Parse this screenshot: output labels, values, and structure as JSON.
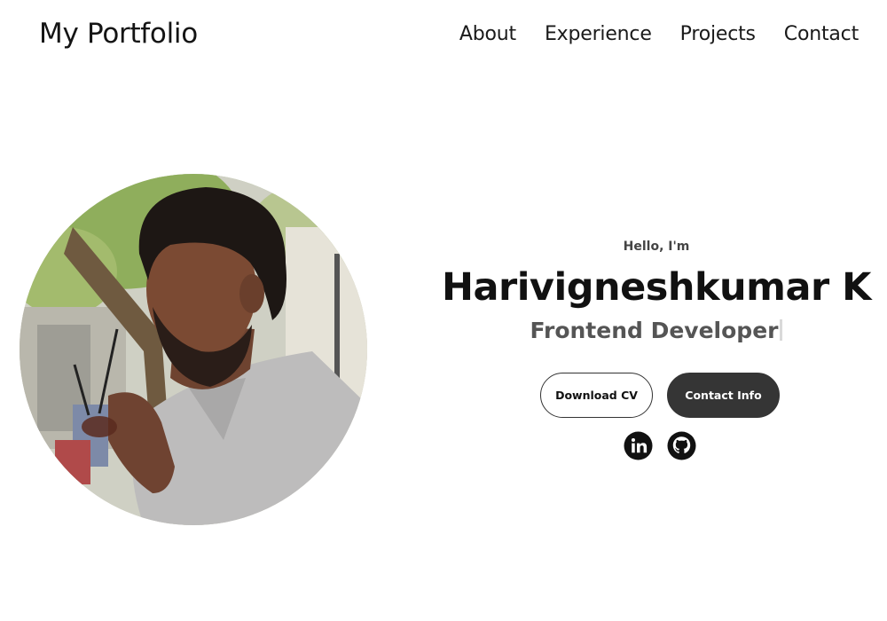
{
  "nav": {
    "logo": "My Portfolio",
    "links": [
      "About",
      "Experience",
      "Projects",
      "Contact"
    ]
  },
  "hero": {
    "greeting": "Hello, I'm",
    "name": "Harivigneshkumar K",
    "role": "Frontend Developer",
    "buttons": {
      "download": "Download CV",
      "contact": "Contact Info"
    },
    "socials": [
      "linkedin-icon",
      "github-icon"
    ]
  },
  "colors": {
    "text": "#111111",
    "role_text": "#555555",
    "dark_button": "#353535",
    "background": "#ffffff"
  }
}
